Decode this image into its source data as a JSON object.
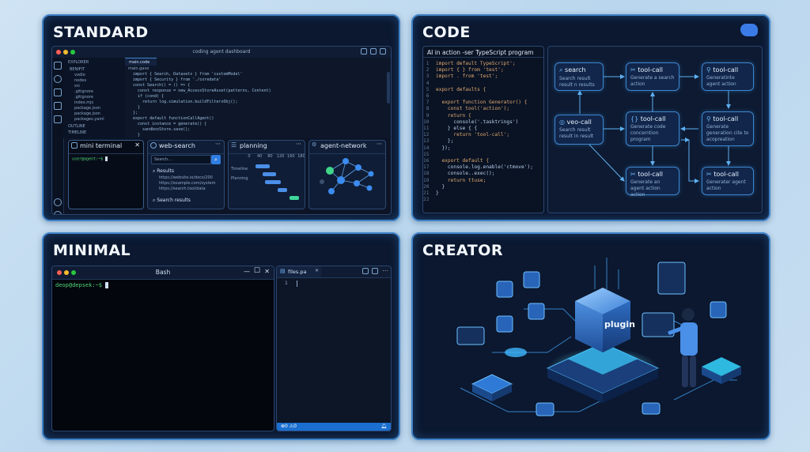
{
  "panels": {
    "standard": {
      "title": "STANDARD",
      "window_title": "coding agent dashboard",
      "explorer_label": "EXPLORER",
      "editor_tab": "main.code",
      "breadcrumb": "main.gavo",
      "tree": [
        "BENIFIT",
        "vodio",
        "nodes",
        "src",
        ".gitignore",
        ".gitignore",
        "index.mjs",
        "package.json",
        "package.json",
        "packages.yaml"
      ],
      "outline_label": "OUTLINE",
      "timeline_label": "TIMELINE",
      "code_lines": [
        "import { Search, Datasets } from 'customModel'",
        "import { Security } from './coredata'",
        "",
        "const Search() = () => {",
        "  const response = new_AccessStoreAsset(patterns, Content)",
        "",
        "  if (cond) {",
        "    return log.simulation.buildFiltersObj();",
        "  }",
        "};",
        "",
        "export default functionCallAgent()",
        "  const instance = generate() {",
        "    sandboxStore.save();",
        "  }"
      ],
      "mini_terminal": {
        "title": "mini terminal",
        "prompt": "user@agent:~$ "
      },
      "web_search": {
        "title": "web-search",
        "placeholder": "Search...",
        "results_label": "Results",
        "results": [
          "https://website.io/docs/200",
          "https://example.com/system",
          "https://search.tool/data"
        ],
        "footer": "Search results"
      },
      "planning": {
        "title": "planning",
        "ticks": [
          "0",
          "40",
          "80",
          "120",
          "160",
          "180"
        ],
        "rows": [
          "Timeline",
          "Planning"
        ],
        "bars": [
          {
            "start": 0.12,
            "end": 0.4
          },
          {
            "start": 0.26,
            "end": 0.52
          },
          {
            "start": 0.3,
            "end": 0.6
          },
          {
            "start": 0.55,
            "end": 0.72
          },
          {
            "start": 0.78,
            "end": 0.96
          }
        ]
      },
      "agent_network": {
        "title": "agent-network"
      }
    },
    "code": {
      "title": "CODE",
      "editor_title": "AI in action -ser TypeScript program",
      "code_lines": [
        "import default TypeScript';",
        "import { } from 'test';",
        "import . from 'test';",
        "",
        "export defaults {",
        "",
        "  export function Generator() {",
        "    const tool('action');",
        "    return {",
        "      console('.tasktrings')",
        "    } else { {",
        "      return 'tool-call';",
        "    };",
        "  });",
        "",
        "  export default {",
        "    console.log.enable('ctmove');",
        "    console..exec();",
        "    return ttuse;",
        "  }",
        "}",
        ""
      ],
      "nodes": {
        "search": {
          "title": "search",
          "desc": "Search result result n results"
        },
        "tool1": {
          "title": "tool-call",
          "desc": "Generate a search action"
        },
        "tool2": {
          "title": "tool-call",
          "desc": "Generatinte agent action"
        },
        "veo": {
          "title": "veo-call",
          "desc": "Search result result in result"
        },
        "tool3": {
          "title": "tool-call",
          "desc": "Generate code concerntion program"
        },
        "tool4": {
          "title": "tool-call",
          "desc": "Generate generation cite to acopreation"
        },
        "tool5": {
          "title": "tool-call",
          "desc": "Generate an agent action action"
        },
        "tool6": {
          "title": "tool-call",
          "desc": "Generater agent action"
        }
      }
    },
    "minimal": {
      "title": "MINIMAL",
      "terminal_title": "Bash",
      "prompt": "deop@depsek:~$ ",
      "file_tab": "files.pa",
      "line_number": "1",
      "status": "⊗0 ⚠0"
    },
    "creator": {
      "title": "CREATOR",
      "cube_label": "plugin"
    }
  },
  "colors": {
    "accent": "#3f82c7",
    "node_border": "#3d86cf",
    "bar_blue": "#4a8fe8",
    "bar_green": "#3fd69a",
    "green_prompt": "#4fd67a",
    "status_bar": "#1a6fd0"
  }
}
